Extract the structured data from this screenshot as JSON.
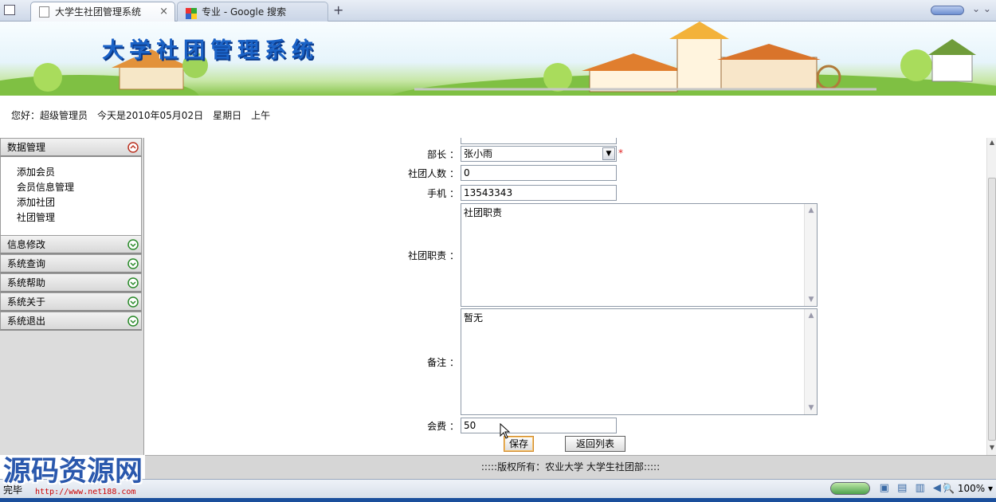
{
  "browser": {
    "tabs": [
      {
        "title": "大学生社团管理系统",
        "active": true
      },
      {
        "title": "专业 - Google 搜索",
        "active": false
      }
    ],
    "new_tab_symbol": "+",
    "close_symbol": "×"
  },
  "banner": {
    "title": "大学社团管理系统"
  },
  "greeting": "您好：超级管理员　今天是2010年05月02日　星期日　上午",
  "sidebar": {
    "sections": [
      {
        "label": "数据管理",
        "expanded": true,
        "items": [
          "添加会员",
          "会员信息管理",
          "添加社团",
          "社团管理"
        ]
      },
      {
        "label": "信息修改",
        "expanded": false
      },
      {
        "label": "系统查询",
        "expanded": false
      },
      {
        "label": "系统帮助",
        "expanded": false
      },
      {
        "label": "系统关于",
        "expanded": false
      },
      {
        "label": "系统退出",
        "expanded": false
      }
    ]
  },
  "form": {
    "leader_label": "部长 ：",
    "leader_value": "张小雨",
    "required_mark": "*",
    "members_label": "社团人数 ：",
    "members_value": "0",
    "phone_label": "手机 ：",
    "phone_value": "13543343",
    "duty_label": "社团职责 ：",
    "duty_value": "社团职责",
    "remark_label": "备注 ：",
    "remark_value": "暂无",
    "fee_label": "会费 ：",
    "fee_value": "50",
    "save_button": "保存",
    "back_button": "返回列表"
  },
  "footer": {
    "copyright": ":::::版权所有：农业大学  大学生社团部:::::"
  },
  "statusbar": {
    "status": "完毕",
    "zoom": "100%"
  },
  "watermark": {
    "text": "源码资源网",
    "url": "http://www.net188.com"
  },
  "colors": {
    "accent": "#1b63c7",
    "required": "#e02020",
    "footer_bg": "#d6d6d6",
    "sidebar_bg": "#dcdcdc"
  }
}
